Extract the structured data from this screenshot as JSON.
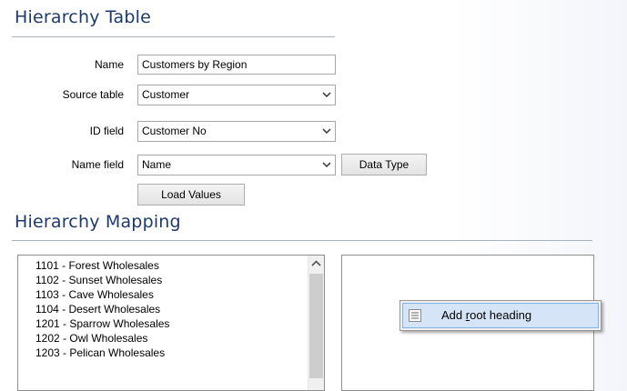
{
  "table_section": {
    "title": "Hierarchy Table"
  },
  "form": {
    "name_label": "Name",
    "name_value": "Customers by Region",
    "source_label": "Source table",
    "source_value": "Customer",
    "id_label": "ID field",
    "id_value": "Customer No",
    "namefield_label": "Name field",
    "namefield_value": "Name",
    "data_type_button": "Data Type",
    "load_values_button": "Load Values"
  },
  "mapping_section": {
    "title": "Hierarchy Mapping"
  },
  "source_list": {
    "items": [
      "1101 - Forest Wholesales",
      "1102 - Sunset Wholesales",
      "1103 - Cave Wholesales",
      "1104 - Desert Wholesales",
      "1201 - Sparrow Wholesales",
      "1202 - Owl Wholesales",
      "1203 - Pelican Wholesales"
    ]
  },
  "context_menu": {
    "item_prefix": "Add ",
    "item_mnemonic": "r",
    "item_suffix": "oot heading",
    "item_icon": "list-icon"
  },
  "colors": {
    "title": "#1e3a6a",
    "menu_highlight": "#d5e5f7"
  }
}
